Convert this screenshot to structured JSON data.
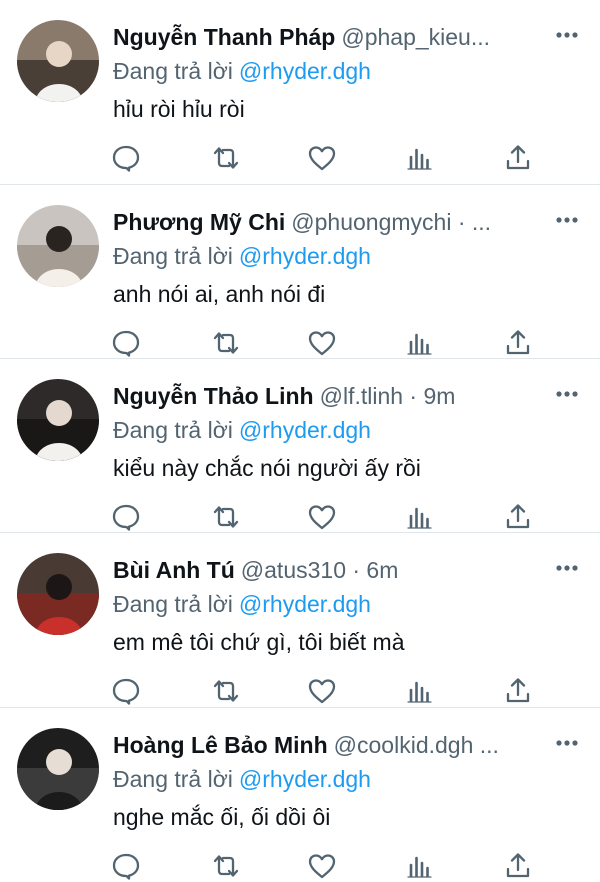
{
  "colors": {
    "text": "#0f1419",
    "secondary": "#536471",
    "accent": "#1d9bf0",
    "divider": "#e1e6ea"
  },
  "replies": [
    {
      "name": "Nguyễn Thanh Pháp",
      "handle": "@phap_kieu...",
      "replying_label": "Đang trả lời",
      "replying_to": "@rhyder.dgh",
      "text": "hỉu ròi hỉu ròi"
    },
    {
      "name": "Phương Mỹ Chi",
      "handle": "@phuongmychi · ...",
      "replying_label": "Đang trả lời",
      "replying_to": "@rhyder.dgh",
      "text": "anh nói ai, anh nói đi"
    },
    {
      "name": "Nguyễn Thảo Linh",
      "handle": "@lf.tlinh · 9m",
      "replying_label": "Đang trả lời",
      "replying_to": "@rhyder.dgh",
      "text": "kiểu này chắc nói người ấy rồi"
    },
    {
      "name": "Bùi Anh Tú",
      "handle": "@atus310 · 6m",
      "replying_label": "Đang trả lời",
      "replying_to": "@rhyder.dgh",
      "text": "em mê tôi chứ gì, tôi biết mà"
    },
    {
      "name": "Hoàng Lê Bảo Minh",
      "handle": "@coolkid.dgh ...",
      "replying_label": "Đang trả lời",
      "replying_to": "@rhyder.dgh",
      "text": "nghe mắc ối, ối dồi ôi"
    }
  ],
  "icons": {
    "more": "more-horizontal-icon",
    "reply": "reply-bubble-icon",
    "retweet": "retweet-icon",
    "like": "heart-icon",
    "stats": "stats-bars-icon",
    "share": "share-icon"
  }
}
